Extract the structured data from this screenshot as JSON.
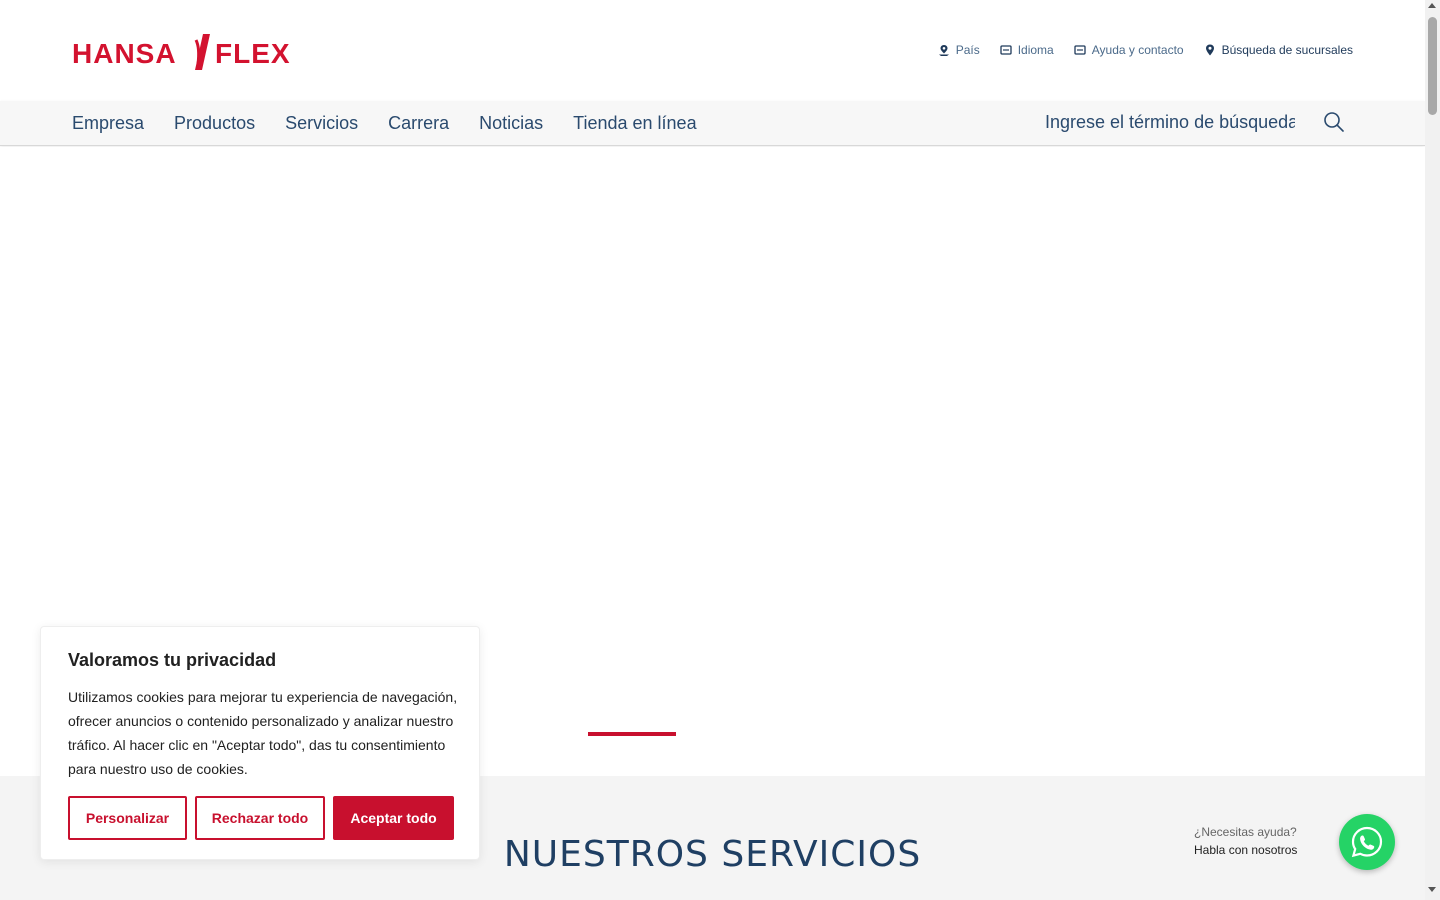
{
  "brand": {
    "logo_left": "HANSA",
    "logo_right": "FLEX",
    "color": "#d3122f"
  },
  "meta_links": [
    {
      "label": "País",
      "icon": "country-pin-icon"
    },
    {
      "label": "Idioma",
      "icon": "language-icon"
    },
    {
      "label": "Ayuda y contacto",
      "icon": "help-contact-icon"
    },
    {
      "label": "Búsqueda de sucursales",
      "icon": "location-pin-icon"
    }
  ],
  "nav": {
    "items": [
      "Empresa",
      "Productos",
      "Servicios",
      "Carrera",
      "Noticias",
      "Tienda en línea"
    ],
    "search_placeholder": "Ingrese el término de búsqueda",
    "search_icon": "search-icon"
  },
  "hero": {
    "active_slide_indicator_color": "#c8102e"
  },
  "services": {
    "title": "NUESTROS SERVICIOS"
  },
  "cookie": {
    "title": "Valoramos tu privacidad",
    "text": "Utilizamos cookies para mejorar tu experiencia de navegación, ofrecer anuncios o contenido personalizado y analizar nuestro tráfico. Al hacer clic en \"Aceptar todo\", das tu consentimiento para nuestro uso de cookies.",
    "buttons": {
      "customize": "Personalizar",
      "reject": "Rechazar todo",
      "accept": "Aceptar todo"
    },
    "accent": "#c8102e"
  },
  "whatsapp": {
    "line1": "¿Necesitas ayuda?",
    "line2": "Habla con nosotros",
    "icon": "whatsapp-icon",
    "color": "#25d366"
  }
}
